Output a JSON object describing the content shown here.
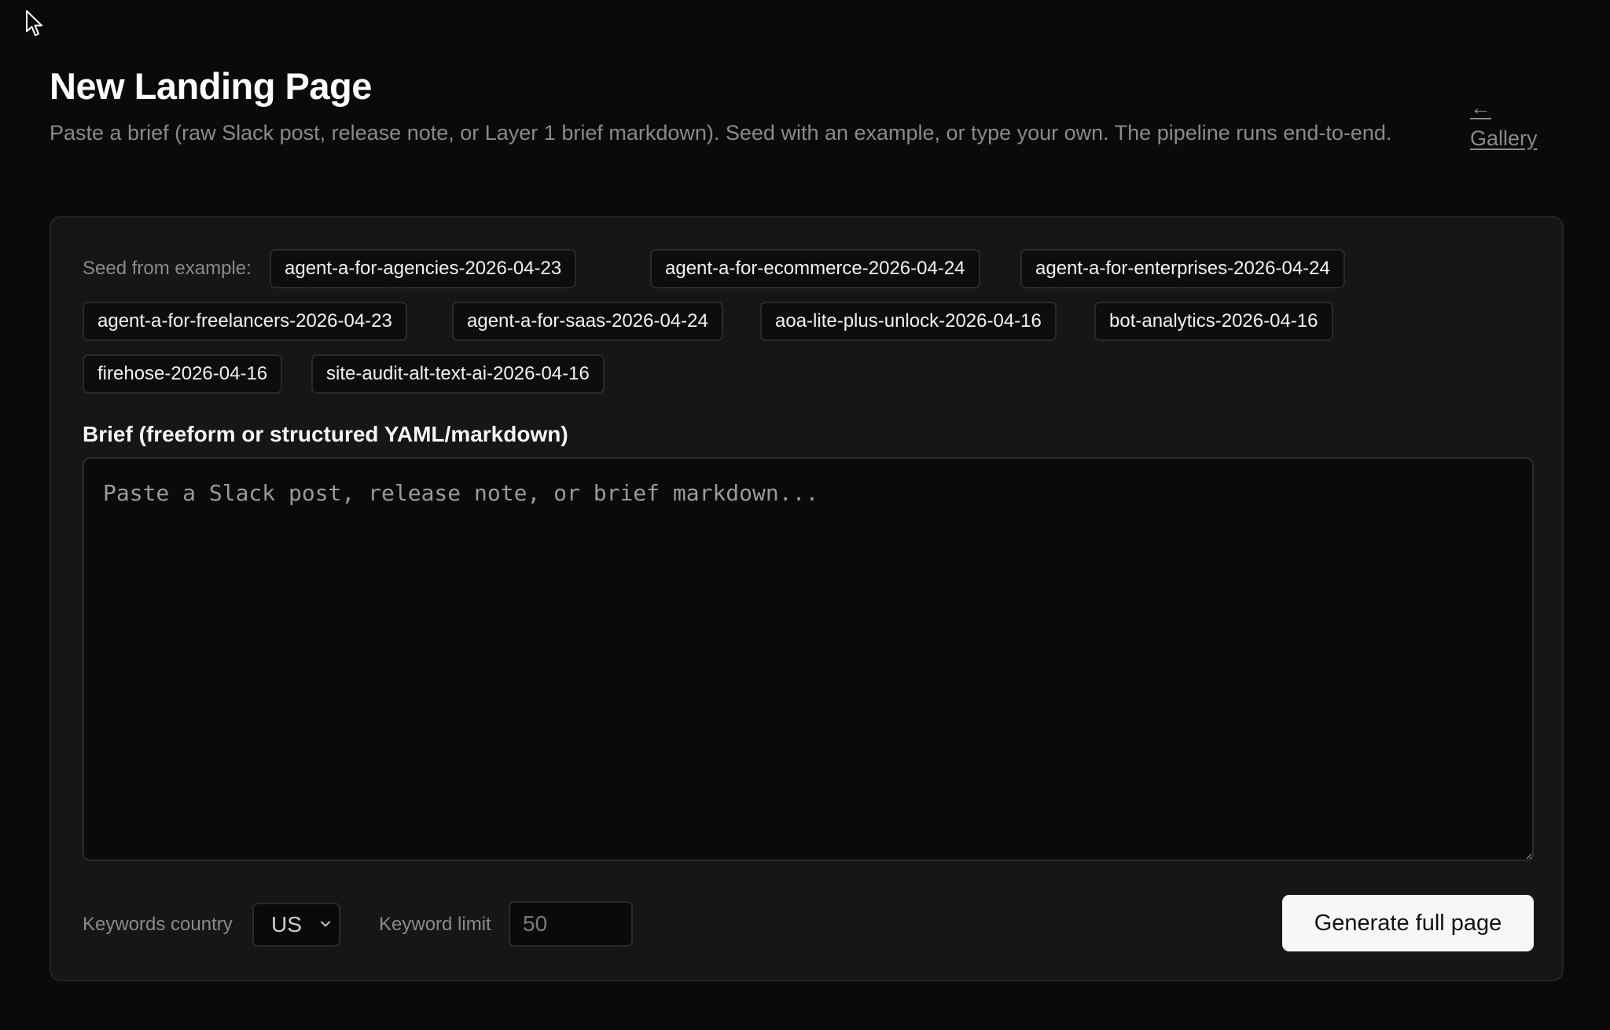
{
  "header": {
    "title": "New Landing Page",
    "subtitle": "Paste a brief (raw Slack post, release note, or Layer 1 brief markdown). Seed with an example, or type your own. The pipeline runs end-to-end.",
    "gallery_arrow": "←",
    "gallery_link": "Gallery"
  },
  "seed": {
    "label": "Seed from example:",
    "examples": [
      "agent-a-for-agencies-2026-04-23",
      "agent-a-for-ecommerce-2026-04-24",
      "agent-a-for-enterprises-2026-04-24",
      "agent-a-for-freelancers-2026-04-23",
      "agent-a-for-saas-2026-04-24",
      "aoa-lite-plus-unlock-2026-04-16",
      "bot-analytics-2026-04-16",
      "firehose-2026-04-16",
      "site-audit-alt-text-ai-2026-04-16"
    ]
  },
  "brief": {
    "label": "Brief (freeform or structured YAML/markdown)",
    "value": "",
    "placeholder": "Paste a Slack post, release note, or brief markdown..."
  },
  "controls": {
    "country_label": "Keywords country",
    "country_value": "US",
    "limit_label": "Keyword limit",
    "limit_value": "",
    "limit_placeholder": "50",
    "generate_label": "Generate full page"
  },
  "icons": {
    "cursor": "mouse-pointer-icon",
    "back": "arrow-left-icon",
    "chevron": "chevron-down-icon"
  },
  "colors": {
    "background": "#0a0a0a",
    "panel": "#161616",
    "muted_text": "#8a8a8a",
    "button_bg": "#f7f7f7"
  }
}
